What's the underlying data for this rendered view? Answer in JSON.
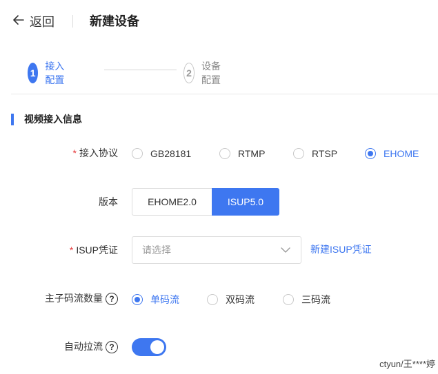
{
  "header": {
    "back_label": "返回",
    "title": "新建设备"
  },
  "steps": [
    {
      "num": "1",
      "label": "接入配置",
      "state": "active"
    },
    {
      "num": "2",
      "label": "设备配置",
      "state": "inactive"
    }
  ],
  "section": {
    "title": "视频接入信息"
  },
  "form": {
    "protocol": {
      "label": "接入协议",
      "required": "*",
      "options": [
        "GB28181",
        "RTMP",
        "RTSP",
        "EHOME"
      ],
      "selected": "EHOME"
    },
    "version": {
      "label": "版本",
      "options": [
        "EHOME2.0",
        "ISUP5.0"
      ],
      "selected": "ISUP5.0"
    },
    "isup_credential": {
      "label": "ISUP凭证",
      "required": "*",
      "placeholder": "请选择",
      "new_link": "新建ISUP凭证"
    },
    "stream_count": {
      "label": "主子码流数量",
      "options": [
        "单码流",
        "双码流",
        "三码流"
      ],
      "selected": "单码流"
    },
    "auto_pull": {
      "label": "自动拉流",
      "value": "on"
    }
  },
  "colors": {
    "primary": "#3e77f0",
    "required": "#e5393b"
  },
  "watermark": "ctyun/王****婷"
}
